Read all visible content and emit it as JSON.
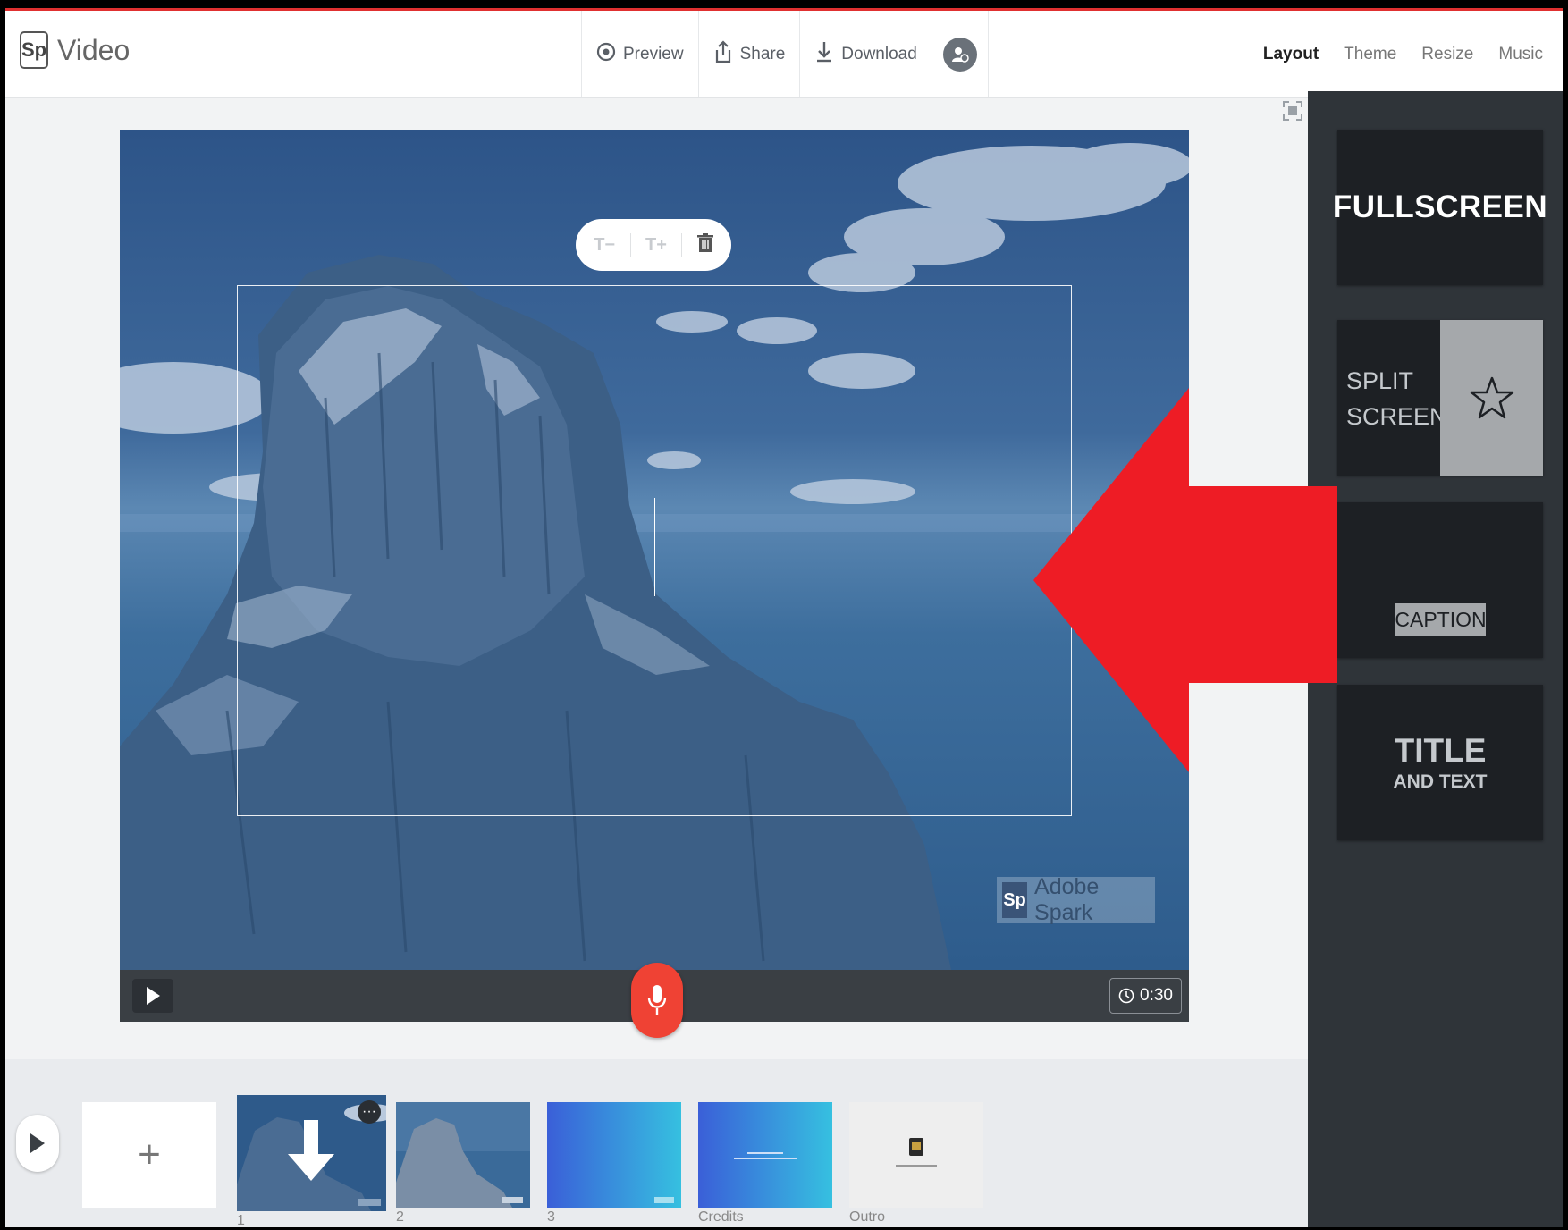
{
  "app": {
    "logo_mark": "Sp",
    "title": "Video"
  },
  "header": {
    "actions": [
      {
        "label": "Preview",
        "icon": "eye-icon"
      },
      {
        "label": "Share",
        "icon": "share-icon"
      },
      {
        "label": "Download",
        "icon": "download-icon"
      }
    ],
    "avatar_icon": "add-collaborator-icon",
    "nav": [
      {
        "label": "Layout",
        "active": true
      },
      {
        "label": "Theme",
        "active": false
      },
      {
        "label": "Resize",
        "active": false
      },
      {
        "label": "Music",
        "active": false
      }
    ]
  },
  "canvas": {
    "toolbar": {
      "decrease": "T−",
      "increase": "T+",
      "delete_icon": "trash-icon"
    },
    "watermark": {
      "mark": "Sp",
      "text": "Adobe Spark"
    },
    "duration": "0:30",
    "mic_icon": "microphone-icon"
  },
  "layouts": {
    "fullscreen": "FULLSCREEN",
    "split_line1": "SPLIT",
    "split_line2": "SCREEN",
    "caption": "CAPTION",
    "title_big": "TITLE",
    "title_small": "AND TEXT"
  },
  "timeline": {
    "add_label": "+",
    "slides": [
      {
        "label": "1",
        "selected": true
      },
      {
        "label": "2",
        "selected": false
      },
      {
        "label": "3",
        "selected": false
      },
      {
        "label": "Credits",
        "selected": false
      },
      {
        "label": "Outro",
        "selected": false
      }
    ]
  },
  "colors": {
    "accent_red": "#ef4234",
    "arrow_red": "#ee1c25",
    "panel_bg": "#2f3439"
  }
}
